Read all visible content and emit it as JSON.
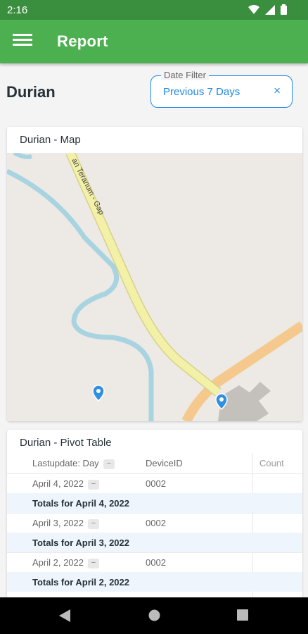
{
  "status_bar": {
    "time": "2:16"
  },
  "app_bar": {
    "title": "Report"
  },
  "page": {
    "title": "Durian"
  },
  "date_filter": {
    "label": "Date Filter",
    "value": "Previous 7 Days",
    "clear_symbol": "×"
  },
  "map_card": {
    "title": "Durian - Map",
    "road_label": "an Teranum - Gap"
  },
  "pivot": {
    "title": "Durian - Pivot Table",
    "headers": {
      "day": "Lastupdate: Day",
      "device": "DeviceID",
      "count": "Count"
    },
    "collapse_symbol": "−",
    "rows": [
      {
        "date": "April 4, 2022",
        "device": "0002",
        "total": "Totals for April 4, 2022"
      },
      {
        "date": "April 3, 2022",
        "device": "0002",
        "total": "Totals for April 3, 2022"
      },
      {
        "date": "April 2, 2022",
        "device": "0002",
        "total": "Totals for April 2, 2022"
      }
    ]
  },
  "colors": {
    "appbar": "#4caf50",
    "statusbar": "#3a8f3e",
    "accent": "#1e88e5",
    "river": "#a8d3e0",
    "road": "#f3f0a8",
    "road_orange": "#f5c98d"
  },
  "icons": [
    "wifi-icon",
    "signal-icon",
    "battery-icon",
    "menu-icon",
    "close-icon",
    "map-pin-icon",
    "back-icon",
    "home-icon",
    "recents-icon"
  ]
}
